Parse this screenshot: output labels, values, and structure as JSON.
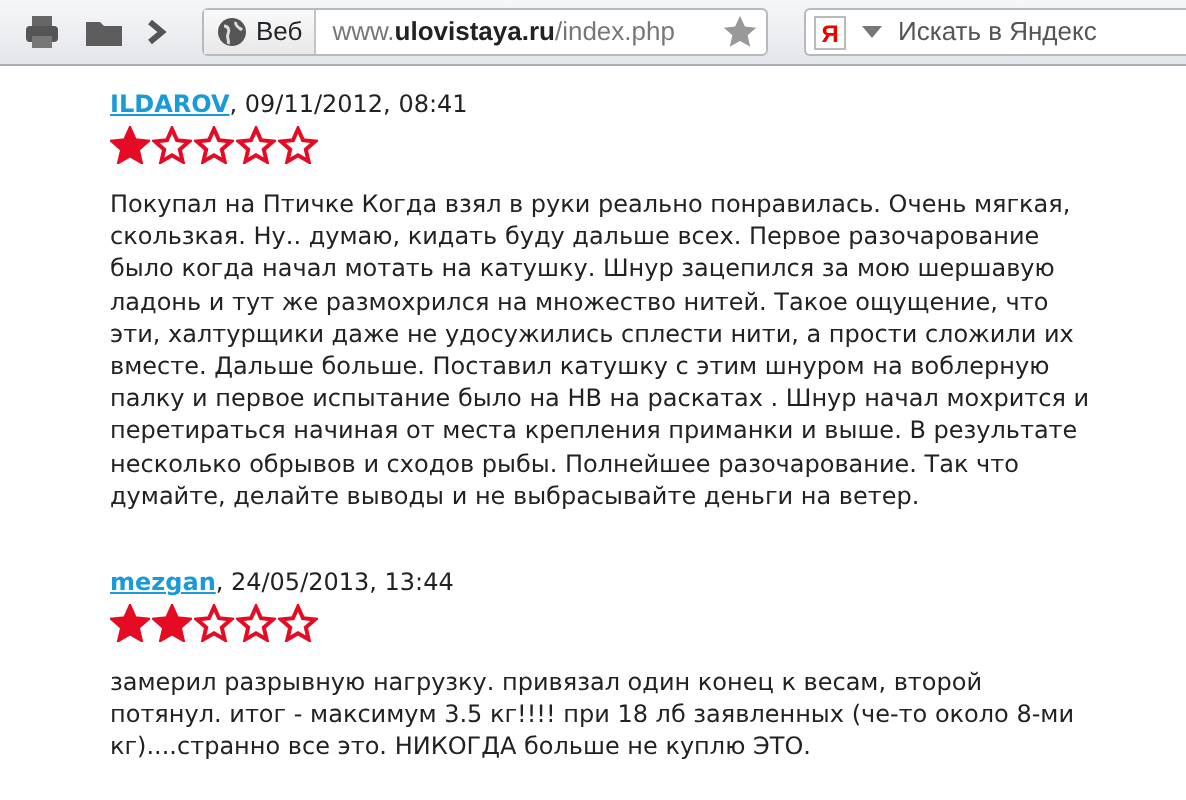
{
  "toolbar": {
    "address_bar": {
      "prefix": "Веб",
      "url": "www.**ulovistaya.ru**/index.php"
    },
    "search": {
      "logo": "Я",
      "placeholder": "Искать в Яндекс"
    }
  },
  "comments": [
    {
      "author": "ILDAROV",
      "date": ", 09/11/2012, 08:41",
      "stars": 1,
      "text": "Покупал на Птичке Когда взял в руки реально понравилась. Очень мягкая, скользкая. Ну.. думаю, кидать буду дальше всех. Первое разочарование было когда начал мотать на катушку. Шнур зацепился за мою шершавую ладонь и тут же размохрился на множество нитей. Такое ощущение, что эти, халтурщики даже не удосужились сплести нити, а прости сложили их вместе. Дальше больше. Поставил катушку с этим шнуром на воблерную палку и первое испытание было на НВ на раскатах . Шнур начал мохрится и перетираться начиная от места крепления приманки и выше. В результате несколько обрывов и сходов рыбы. Полнейшее разочарование. Так что думайте, делайте выводы и не выбрасывайте деньги на ветер."
    },
    {
      "author": "mezgan",
      "date": ", 24/05/2013, 13:44",
      "stars": 2,
      "text": "замерил разрывную нагрузку. привязал один конец к весам, второй потянул. итог - максимум 3.5 кг!!!! при 18 лб заявленных (че-то около 8-ми кг)....странно все это. НИКОГДА больше не куплю ЭТО."
    }
  ]
}
